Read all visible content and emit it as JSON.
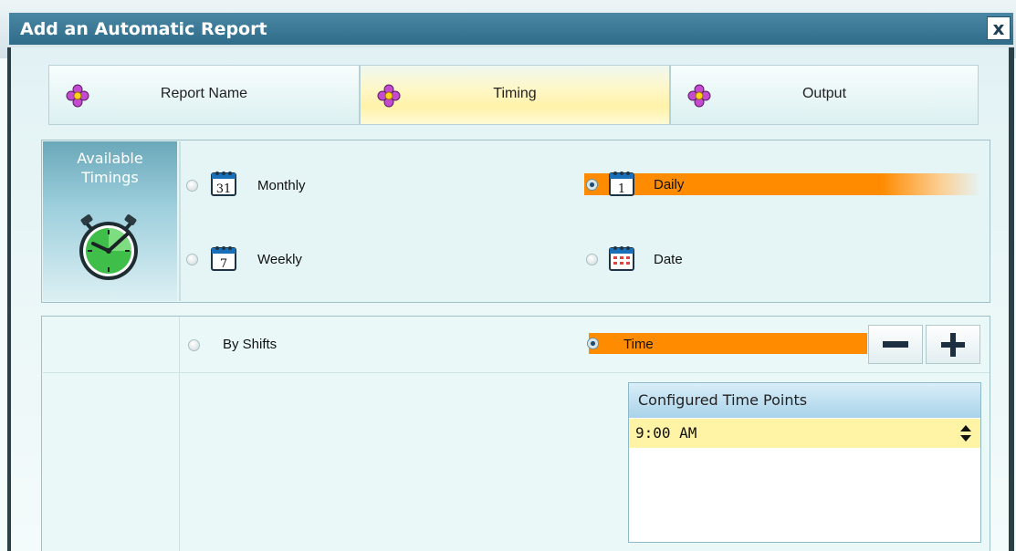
{
  "window": {
    "title": "Add an Automatic Report",
    "close_label": "x"
  },
  "tabs": [
    {
      "label": "Report Name",
      "icon": "flower-icon",
      "active": false
    },
    {
      "label": "Timing",
      "icon": "flower-icon",
      "active": true
    },
    {
      "label": "Output",
      "icon": "flower-icon",
      "active": false
    }
  ],
  "timings": {
    "heading": "Available\nTimings",
    "heading_line1": "Available",
    "heading_line2": "Timings",
    "icon": "stopwatch-icon",
    "options": {
      "monthly": {
        "label": "Monthly",
        "icon_text": "31",
        "selected": false
      },
      "daily": {
        "label": "Daily",
        "icon_text": "1",
        "selected": true
      },
      "weekly": {
        "label": "Weekly",
        "icon_text": "7",
        "selected": false
      },
      "date": {
        "label": "Date",
        "selected": false
      }
    }
  },
  "schedule": {
    "by_shifts_label": "By Shifts",
    "by_shifts_selected": false,
    "time_label": "Time",
    "time_selected": true,
    "minus_icon": "minus-icon",
    "plus_icon": "plus-icon"
  },
  "time_points": {
    "header": "Configured Time Points",
    "items": [
      "9:00 AM"
    ]
  },
  "colors": {
    "title_bar": "#3a7998",
    "selection": "#ff8b00",
    "active_tab": "#fff2a9",
    "time_point_row": "#fff3a6"
  }
}
